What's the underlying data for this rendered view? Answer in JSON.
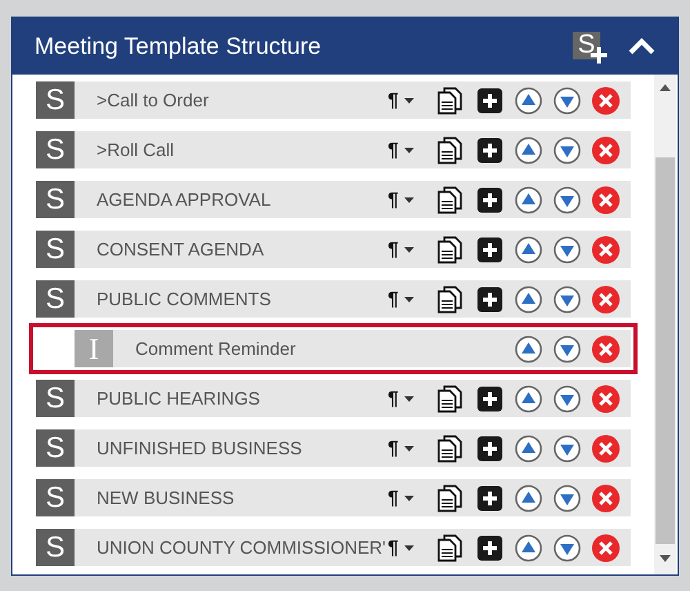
{
  "panel": {
    "title": "Meeting Template Structure",
    "add_section_icon_letter": "S",
    "expanded": true
  },
  "items": [
    {
      "kind": "section",
      "badge": "S",
      "label": ">Call to Order",
      "format_menu": "¶",
      "selected": false
    },
    {
      "kind": "section",
      "badge": "S",
      "label": ">Roll Call",
      "format_menu": "¶",
      "selected": false
    },
    {
      "kind": "section",
      "badge": "S",
      "label": "AGENDA APPROVAL",
      "format_menu": "¶",
      "selected": false
    },
    {
      "kind": "section",
      "badge": "S",
      "label": "CONSENT AGENDA",
      "format_menu": "¶",
      "selected": false
    },
    {
      "kind": "section",
      "badge": "S",
      "label": "PUBLIC COMMENTS",
      "format_menu": "¶",
      "selected": false,
      "children": [
        {
          "kind": "item",
          "badge": "I",
          "label": "Comment Reminder",
          "selected": true
        }
      ]
    },
    {
      "kind": "section",
      "badge": "S",
      "label": "PUBLIC HEARINGS",
      "format_menu": "¶",
      "selected": false
    },
    {
      "kind": "section",
      "badge": "S",
      "label": "UNFINISHED BUSINESS",
      "format_menu": "¶",
      "selected": false
    },
    {
      "kind": "section",
      "badge": "S",
      "label": "NEW BUSINESS",
      "format_menu": "¶",
      "selected": false
    },
    {
      "kind": "section",
      "badge": "S",
      "label": "UNION COUNTY COMMISSIONER'",
      "format_menu": "¶",
      "selected": false
    }
  ]
}
